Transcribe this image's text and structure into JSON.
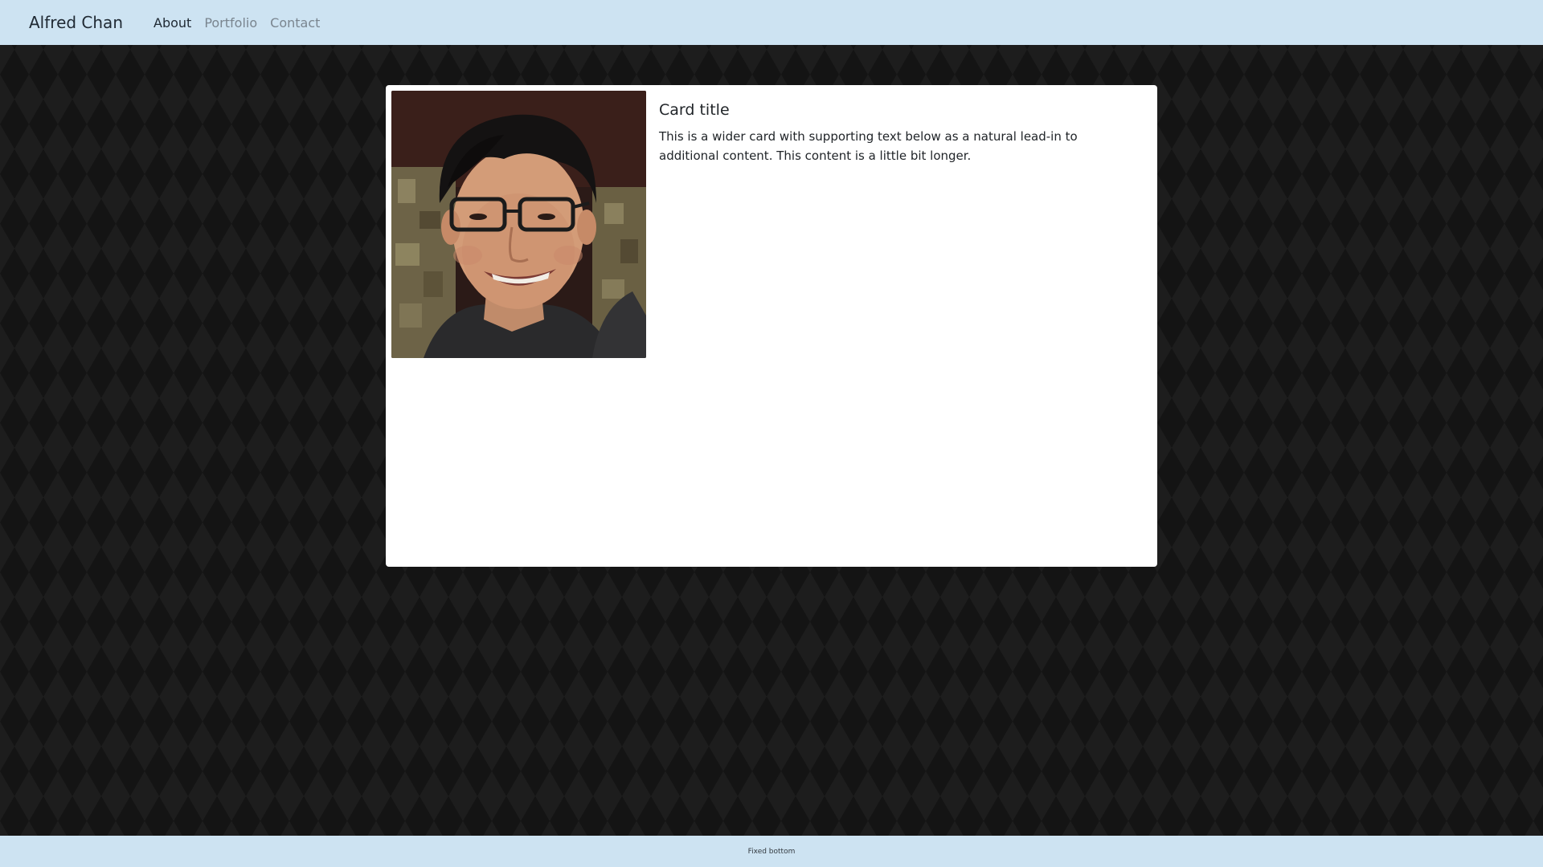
{
  "navbar": {
    "brand": "Alfred Chan",
    "items": [
      {
        "label": "About",
        "active": true
      },
      {
        "label": "Portfolio",
        "active": false
      },
      {
        "label": "Contact",
        "active": false
      }
    ],
    "background": "#cde3f2"
  },
  "card": {
    "image_icon": "profile-photo",
    "title": "Card title",
    "text": "This is a wider card with supporting text below as a natural lead-in to additional content. This content is a little bit longer."
  },
  "footer": {
    "text": "Fixed bottom"
  }
}
